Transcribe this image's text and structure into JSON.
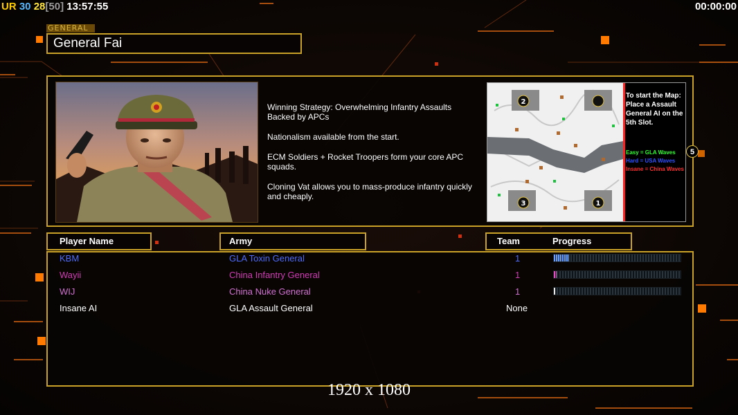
{
  "hud": {
    "label": "UR",
    "value_a": "30",
    "value_b": "28",
    "value_c": "[50]",
    "clock": "13:57:55",
    "timer": "00:00:00"
  },
  "general": {
    "tag": "GENERAL",
    "name": "General Fai"
  },
  "description": [
    "Winning Strategy: Overwhelming Infantry Assaults\n Backed by APCs",
    "Nationalism available from the start.",
    "ECM Soldiers + Rocket Troopers form your core APC\n squads.",
    "Cloning Vat allows you to mass-produce infantry quickly\n and cheaply."
  ],
  "map": {
    "note_title": "To start the Map:",
    "note_body": "Place a Assault General AI on the 5th Slot.",
    "easy": "Easy = GLA Waves",
    "hard": "Hard = USA Waves",
    "insane": "Insane = China Waves",
    "slot_badge": "5",
    "start_positions": [
      "2",
      "3",
      "1"
    ]
  },
  "table": {
    "col_player": "Player Name",
    "col_army": "Army",
    "col_team": "Team",
    "col_progress": "Progress",
    "rows": [
      {
        "player": "KBM",
        "army": "GLA Toxin General",
        "team": "1",
        "progress": 0.12,
        "color": "#4f6cff",
        "bar_color": "#6aa0ff"
      },
      {
        "player": "Wayii",
        "army": "China Infantry General",
        "team": "1",
        "progress": 0.02,
        "color": "#d23bb5",
        "bar_color": "#e050c0"
      },
      {
        "player": "WIJ",
        "army": "China Nuke General",
        "team": "1",
        "progress": 0.01,
        "color": "#d070d0",
        "bar_color": "#e8e8e8"
      },
      {
        "player": "Insane AI",
        "army": "GLA Assault General",
        "team": "None",
        "progress": null,
        "color": "#ffffff",
        "bar_color": ""
      }
    ]
  },
  "resolution": "1920 x 1080",
  "colors": {
    "frame": "#c9a227",
    "accent_orange": "#ff7a00"
  }
}
